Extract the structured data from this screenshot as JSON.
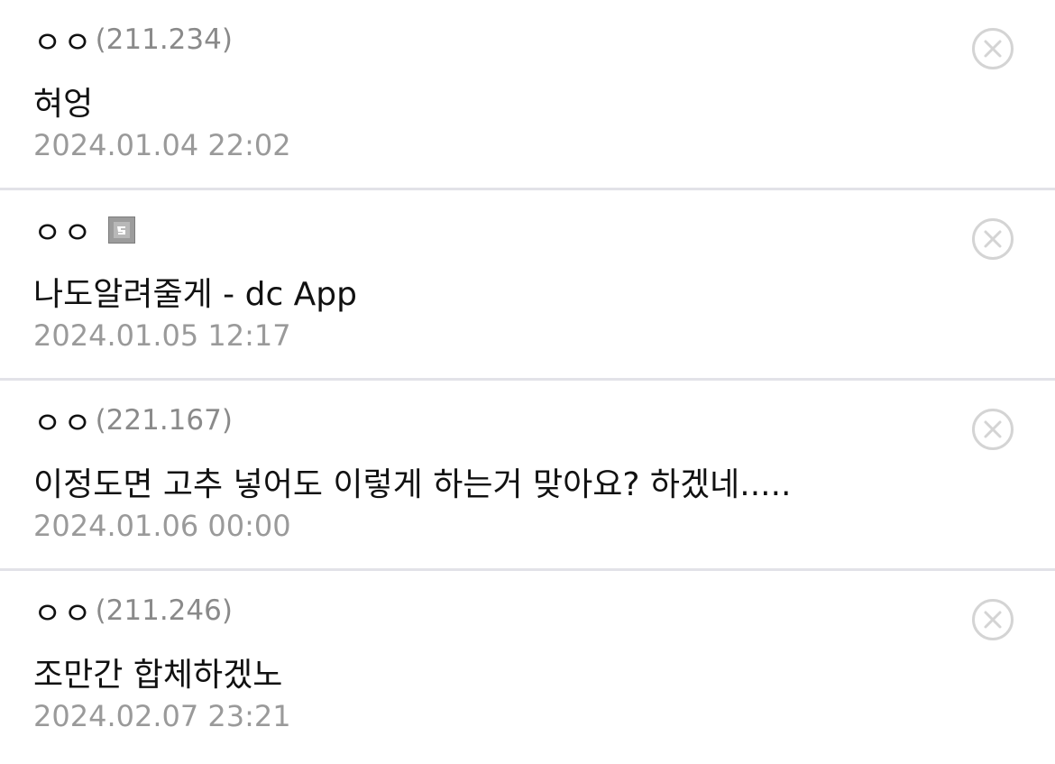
{
  "comments": [
    {
      "nickname": "ㅇㅇ",
      "ip": "(211.234)",
      "member_icon": "",
      "text": "혀엉",
      "date": "2024.01.04 22:02",
      "delete_icon": "circle-x-icon"
    },
    {
      "nickname": "ㅇㅇ",
      "ip": "",
      "member_icon": "fixed-nick-gallery-icon",
      "text": "나도알려줄게 - dc App",
      "date": "2024.01.05 12:17",
      "delete_icon": "circle-x-icon"
    },
    {
      "nickname": "ㅇㅇ",
      "ip": "(221.167)",
      "member_icon": "",
      "text": "이정도면 고추 넣어도 이렇게 하는거 맞아요? 하겠네.....",
      "date": "2024.01.06 00:00",
      "delete_icon": "circle-x-icon"
    },
    {
      "nickname": "ㅇㅇ",
      "ip": "(211.246)",
      "member_icon": "",
      "text": "조만간 합체하겠노",
      "date": "2024.02.07 23:21",
      "delete_icon": "circle-x-icon"
    }
  ],
  "colors": {
    "text": "#111111",
    "meta": "#9a9a9a",
    "divider": "#e2e2e8",
    "delete_icon": "#d4d4d4"
  }
}
